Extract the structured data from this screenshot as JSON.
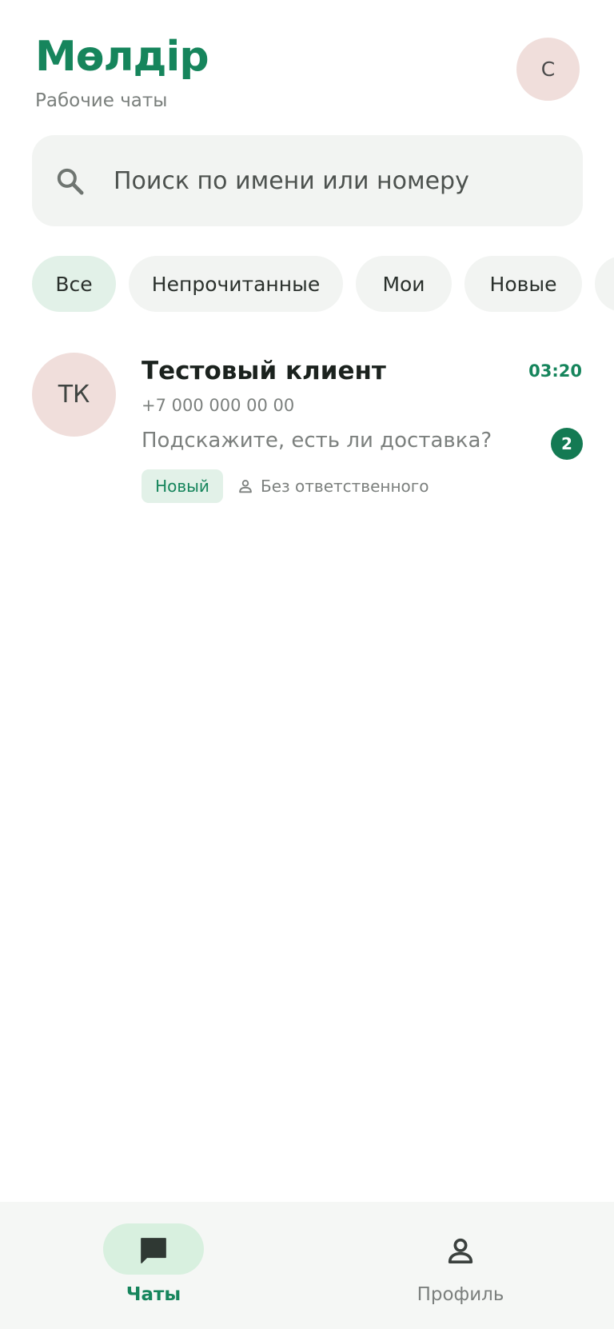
{
  "header": {
    "title": "Мөлдір",
    "subtitle": "Рабочие чаты",
    "profile_initial": "С"
  },
  "search": {
    "placeholder": "Поиск по имени или номеру",
    "icon": "search-icon"
  },
  "filters": [
    {
      "label": "Все",
      "active": true
    },
    {
      "label": "Непрочитанные",
      "active": false
    },
    {
      "label": "Мои",
      "active": false
    },
    {
      "label": "Новые",
      "active": false
    }
  ],
  "chats": [
    {
      "initials": "ТК",
      "name": "Тестовый клиент",
      "time": "03:20",
      "phone": "+7 000 000 00 00",
      "preview": "Подскажите, есть ли доставка?",
      "unread": "2",
      "status": "Новый",
      "assignee": "Без ответственного"
    }
  ],
  "bottom_nav": {
    "items": [
      {
        "label": "Чаты",
        "icon": "chat-icon",
        "active": true
      },
      {
        "label": "Профиль",
        "icon": "person-icon",
        "active": false
      }
    ]
  },
  "colors": {
    "accent": "#16855c",
    "badge": "#147a53",
    "avatar_bg": "#f0dedb",
    "chip_active_bg": "#e2f1e8",
    "surface": "#f2f4f2"
  }
}
